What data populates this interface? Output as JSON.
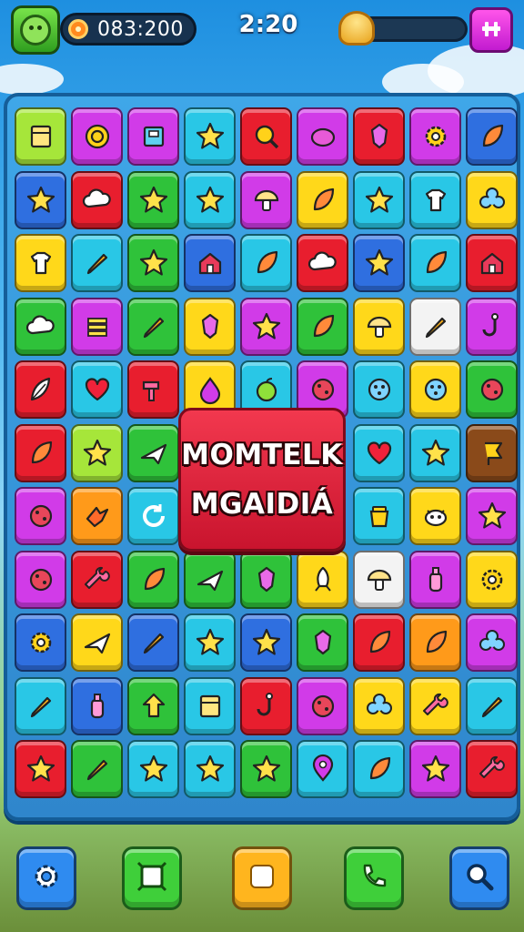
{
  "hud": {
    "score": "083:200",
    "timer": "2:20",
    "level_progress": 0.2,
    "avatar_icon": "green-blob-avatar-icon",
    "coin_icon": "coin-icon",
    "progress_icon": "gold-shell-icon",
    "menu_icon": "grid-menu-icon"
  },
  "popup": {
    "line1": "MOMTELK",
    "line2": "MGAIDIÁ"
  },
  "colors": {
    "board": "#2f86cc",
    "popup": "#e0213a",
    "tile_palette": {
      "p": "#d13be8",
      "l": "#a6e63a",
      "t": "#29c7e6",
      "r": "#e81e2e",
      "y": "#ffd81a",
      "b": "#2f6fe0",
      "g": "#2fc23a",
      "o": "#ff9a1a",
      "w": "#f3f3f3",
      "k": "#8a4a1a"
    }
  },
  "board": {
    "rows": 11,
    "cols": 9,
    "tiles": [
      [
        [
          "l",
          "box"
        ],
        [
          "p",
          "ring"
        ],
        [
          "p",
          "cabinet"
        ],
        [
          "t",
          "star"
        ],
        [
          "r",
          "search"
        ],
        [
          "p",
          "blob"
        ],
        [
          "r",
          "gem"
        ],
        [
          "p",
          "gear"
        ],
        [
          "b",
          "leaf"
        ]
      ],
      [
        [
          "b",
          "star"
        ],
        [
          "r",
          "cloud"
        ],
        [
          "g",
          "star"
        ],
        [
          "t",
          "star"
        ],
        [
          "p",
          "mushroom"
        ],
        [
          "y",
          "leaf"
        ],
        [
          "t",
          "star"
        ],
        [
          "t",
          "shirt"
        ],
        [
          "y",
          "flower"
        ]
      ],
      [
        [
          "y",
          "shirt"
        ],
        [
          "t",
          "pencil"
        ],
        [
          "g",
          "star"
        ],
        [
          "b",
          "house"
        ],
        [
          "t",
          "leaf"
        ],
        [
          "r",
          "cloud"
        ],
        [
          "b",
          "star"
        ],
        [
          "t",
          "leaf"
        ],
        [
          "r",
          "house"
        ]
      ],
      [
        [
          "g",
          "cloud"
        ],
        [
          "p",
          "stack"
        ],
        [
          "g",
          "pencil"
        ],
        [
          "y",
          "gem"
        ],
        [
          "p",
          "star"
        ],
        [
          "g",
          "leaf"
        ],
        [
          "y",
          "mushroom"
        ],
        [
          "w",
          "pencil"
        ],
        [
          "p",
          "hook"
        ]
      ],
      [
        [
          "r",
          "feather"
        ],
        [
          "t",
          "heart"
        ],
        [
          "r",
          "hammer"
        ],
        [
          "y",
          "drop"
        ],
        [
          "t",
          "apple"
        ],
        [
          "p",
          "ball"
        ],
        [
          "t",
          "button"
        ],
        [
          "y",
          "button"
        ],
        [
          "g",
          "ball"
        ]
      ],
      [
        [
          "r",
          "leaf"
        ],
        [
          "l",
          "star"
        ],
        [
          "g",
          "plane"
        ],
        [
          "",
          ""
        ],
        [
          "",
          ""
        ],
        [
          "",
          ""
        ],
        [
          "t",
          "heart"
        ],
        [
          "t",
          "star"
        ],
        [
          "k",
          "flag"
        ]
      ],
      [
        [
          "p",
          "ball"
        ],
        [
          "o",
          "bird"
        ],
        [
          "t",
          "refresh"
        ],
        [
          "",
          ""
        ],
        [
          "",
          ""
        ],
        [
          "",
          ""
        ],
        [
          "t",
          "pot"
        ],
        [
          "y",
          "cow"
        ],
        [
          "p",
          "star"
        ]
      ],
      [
        [
          "p",
          "ball"
        ],
        [
          "r",
          "wrench"
        ],
        [
          "g",
          "leaf"
        ],
        [
          "g",
          "plane"
        ],
        [
          "g",
          "gem"
        ],
        [
          "y",
          "rocket"
        ],
        [
          "w",
          "mushroom"
        ],
        [
          "p",
          "bottle"
        ],
        [
          "y",
          "gear"
        ]
      ],
      [
        [
          "b",
          "gear"
        ],
        [
          "y",
          "plane"
        ],
        [
          "b",
          "pencil"
        ],
        [
          "t",
          "star"
        ],
        [
          "b",
          "star"
        ],
        [
          "g",
          "gem"
        ],
        [
          "r",
          "leaf"
        ],
        [
          "o",
          "leaf"
        ],
        [
          "p",
          "flower"
        ]
      ],
      [
        [
          "t",
          "pencil"
        ],
        [
          "b",
          "bottle"
        ],
        [
          "g",
          "arrow"
        ],
        [
          "t",
          "box"
        ],
        [
          "r",
          "hook"
        ],
        [
          "p",
          "ball"
        ],
        [
          "y",
          "flower"
        ],
        [
          "y",
          "wrench"
        ],
        [
          "t",
          "pencil"
        ]
      ],
      [
        [
          "r",
          "star"
        ],
        [
          "g",
          "pencil"
        ],
        [
          "t",
          "star"
        ],
        [
          "t",
          "star"
        ],
        [
          "g",
          "star"
        ],
        [
          "t",
          "pin"
        ],
        [
          "t",
          "leaf"
        ],
        [
          "p",
          "star"
        ],
        [
          "r",
          "wrench"
        ]
      ]
    ]
  },
  "nav": [
    {
      "name": "settings-button",
      "icon": "gear-icon",
      "color": "#2f8bf0"
    },
    {
      "name": "map-button",
      "icon": "frame-icon",
      "color": "#3fcf3a"
    },
    {
      "name": "home-button",
      "icon": "square-icon",
      "color": "#ffb51e"
    },
    {
      "name": "call-button",
      "icon": "phone-icon",
      "color": "#3fcf3a"
    },
    {
      "name": "search-button",
      "icon": "search-icon",
      "color": "#2f8bf0"
    }
  ]
}
